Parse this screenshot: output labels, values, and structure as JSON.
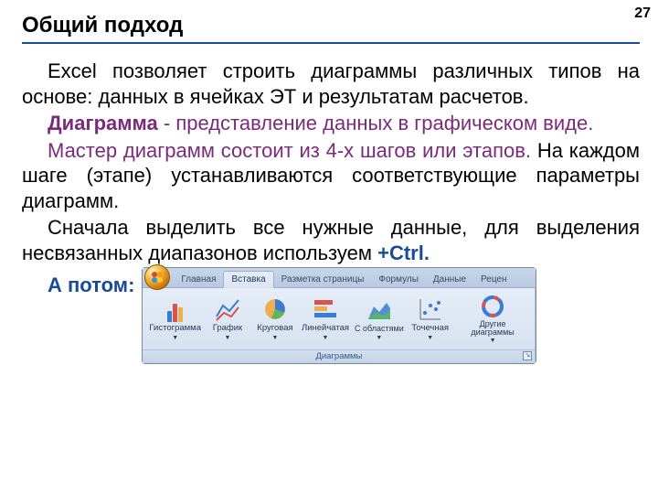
{
  "page_number": "27",
  "title": "Общий подход",
  "body": {
    "p1": "Excel  позволяет строить диаграммы различных типов на основе: данных в ячейках ЭТ и результатам расчетов.",
    "p2_term": "Диаграмма",
    "p2_rest": " -  представление данных в графическом виде.",
    "p3a": "Мастер диаграмм состоит из 4-х шагов или этапов.",
    "p3b": " На каждом шаге (этапе) устанавливаются соответствующие параметры диаграмм.",
    "p4a": "Сначала выделить все нужные данные, для выделения несвязанных диапазонов используем ",
    "p4_ctrl": "+Ctrl.",
    "p5": "А потом:"
  },
  "ribbon": {
    "tabs": [
      "Главная",
      "Вставка",
      "Разметка страницы",
      "Формулы",
      "Данные",
      "Рецен"
    ],
    "active_tab_index": 1,
    "group_title": "Диаграммы",
    "items": [
      {
        "label": "Гистограмма"
      },
      {
        "label": "График"
      },
      {
        "label": "Круговая"
      },
      {
        "label": "Линейчатая"
      },
      {
        "label": "С областями"
      },
      {
        "label": "Точечная"
      },
      {
        "label": "Другие диаграммы"
      }
    ]
  }
}
